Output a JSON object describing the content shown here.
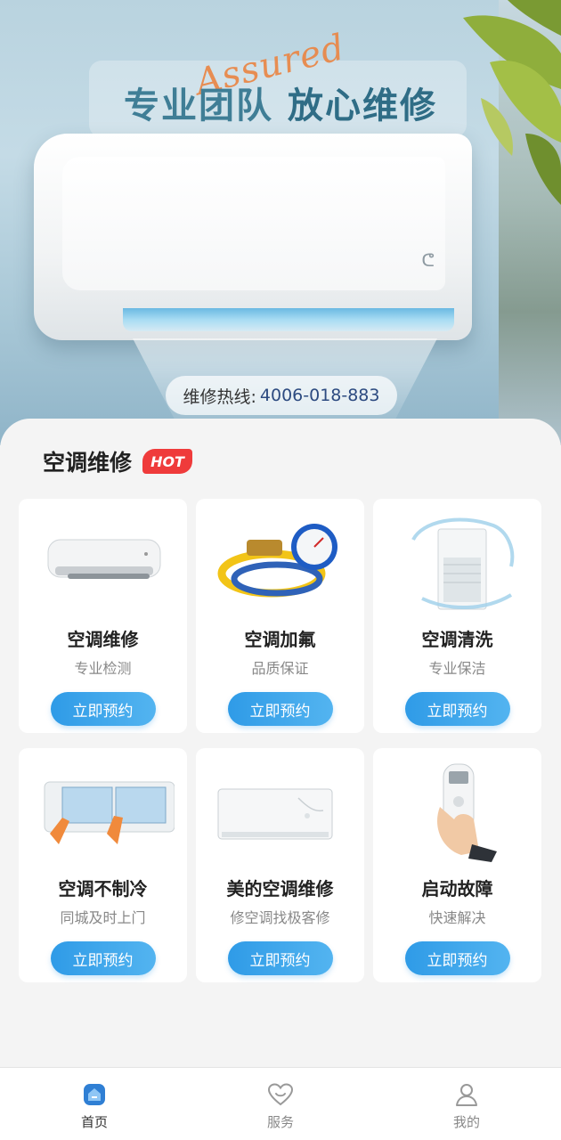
{
  "banner": {
    "script_word": "Assured",
    "headline_part1": "专业团队",
    "headline_part2": "放心维修",
    "hotline_label": "维修热线:",
    "hotline_number": "4006-018-883"
  },
  "section": {
    "title": "空调维修",
    "badge": "HOT"
  },
  "services": [
    {
      "name": "空调维修",
      "subtitle": "专业检测",
      "button": "立即预约",
      "image": "wall-ac-unit"
    },
    {
      "name": "空调加氟",
      "subtitle": "品质保证",
      "button": "立即预约",
      "image": "refrigerant-gauge"
    },
    {
      "name": "空调清洗",
      "subtitle": "专业保洁",
      "button": "立即预约",
      "image": "floor-ac-splash"
    },
    {
      "name": "空调不制冷",
      "subtitle": "同城及时上门",
      "button": "立即预约",
      "image": "ac-filter-cleaning"
    },
    {
      "name": "美的空调维修",
      "subtitle": "修空调找极客修",
      "button": "立即预约",
      "image": "wall-ac-unit-2"
    },
    {
      "name": "启动故障",
      "subtitle": "快速解决",
      "button": "立即预约",
      "image": "remote-control"
    }
  ],
  "tabbar": {
    "items": [
      {
        "label": "首页",
        "icon": "home-icon",
        "active": true
      },
      {
        "label": "服务",
        "icon": "heart-icon",
        "active": false
      },
      {
        "label": "我的",
        "icon": "user-icon",
        "active": false
      }
    ]
  },
  "colors": {
    "accent": "#3a9ee8",
    "hot_badge": "#ef3b3b",
    "headline": "#3f7e96"
  }
}
